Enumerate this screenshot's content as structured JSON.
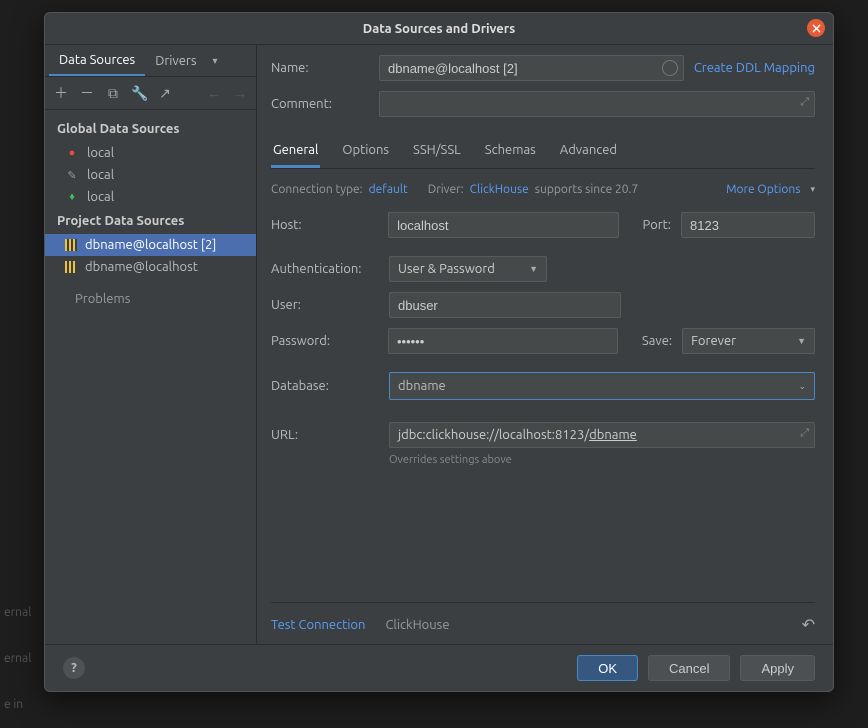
{
  "dialog": {
    "title": "Data Sources and Drivers"
  },
  "leftTabs": {
    "sources": "Data Sources",
    "drivers": "Drivers"
  },
  "tree": {
    "globalHeading": "Global Data Sources",
    "global": [
      {
        "label": "local"
      },
      {
        "label": "local"
      },
      {
        "label": "local"
      }
    ],
    "projectHeading": "Project Data Sources",
    "project": [
      {
        "label": "dbname@localhost [2]"
      },
      {
        "label": "dbname@localhost"
      }
    ],
    "problems": "Problems"
  },
  "form": {
    "nameLabel": "Name:",
    "nameValue": "dbname@localhost [2]",
    "ddlLink": "Create DDL Mapping",
    "commentLabel": "Comment:",
    "tabs": {
      "general": "General",
      "options": "Options",
      "ssh": "SSH/SSL",
      "schemas": "Schemas",
      "advanced": "Advanced"
    },
    "conn": {
      "typeLabel": "Connection type:",
      "typeValue": "default",
      "driverLabel": "Driver:",
      "driverValue": "ClickHouse",
      "supports": "supports since 20.7",
      "more": "More Options"
    },
    "hostLabel": "Host:",
    "hostValue": "localhost",
    "portLabel": "Port:",
    "portValue": "8123",
    "authLabel": "Authentication:",
    "authValue": "User & Password",
    "userLabel": "User:",
    "userValue": "dbuser",
    "passLabel": "Password:",
    "passValue": "••••••",
    "saveLabel": "Save:",
    "saveValue": "Forever",
    "dbLabel": "Database:",
    "dbValue": "dbname",
    "urlLabel": "URL:",
    "urlPrefix": "jdbc:clickhouse://localhost:8123/",
    "urlDb": "dbname",
    "urlHint": "Overrides settings above",
    "testConnection": "Test Connection",
    "driverName": "ClickHouse"
  },
  "footer": {
    "ok": "OK",
    "cancel": "Cancel",
    "apply": "Apply"
  }
}
